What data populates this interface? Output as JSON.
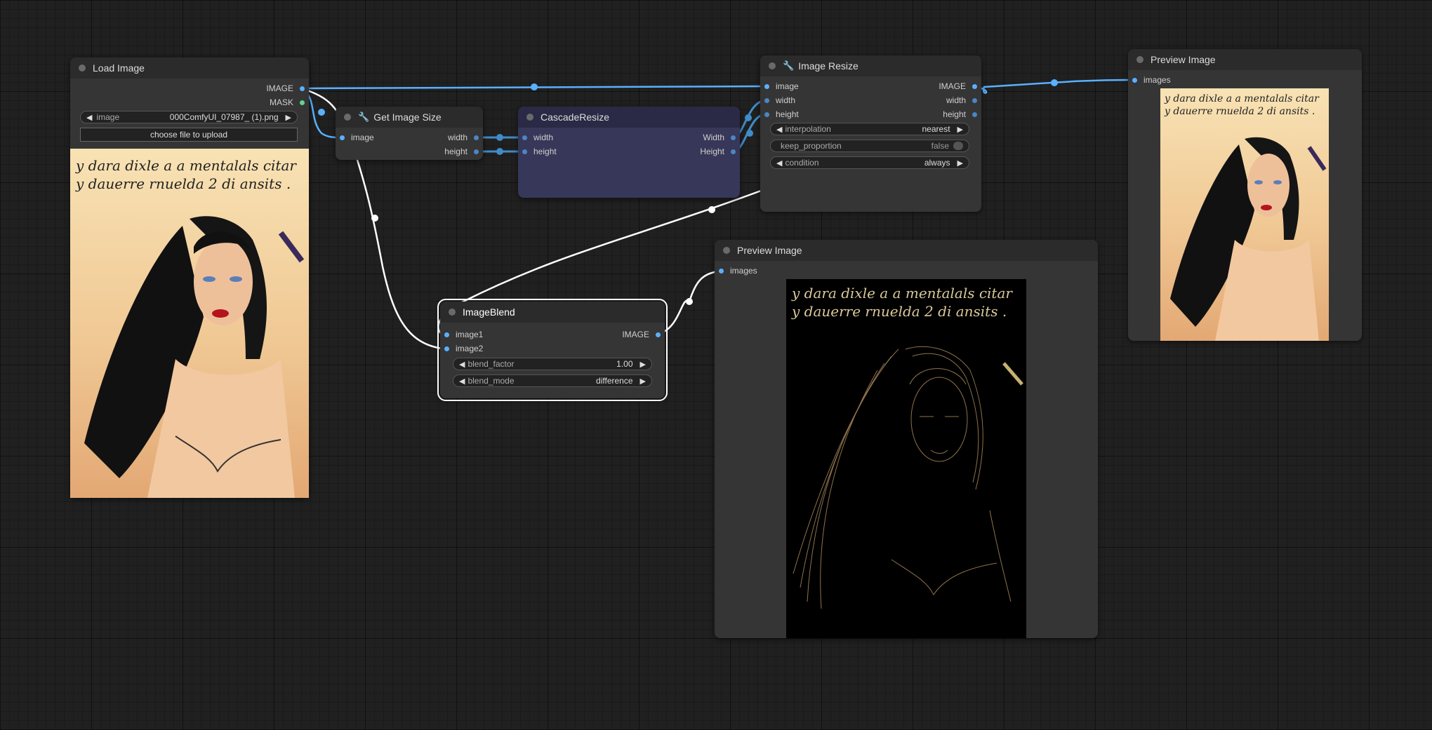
{
  "nodes": {
    "load_image": {
      "title": "Load Image",
      "outputs": [
        "IMAGE",
        "MASK"
      ],
      "widget_label": "image",
      "widget_value": "000ComfyUI_07987_ (1).png",
      "upload_label": "choose file to upload"
    },
    "get_image_size": {
      "title": "Get Image Size",
      "inputs": [
        "image"
      ],
      "outputs": [
        "width",
        "height"
      ]
    },
    "cascade_resize": {
      "title": "CascadeResize",
      "inputs": [
        "width",
        "height"
      ],
      "outputs": [
        "Width",
        "Height"
      ]
    },
    "image_resize": {
      "title": "Image Resize",
      "inputs": [
        "image",
        "width",
        "height"
      ],
      "outputs": [
        "IMAGE",
        "width",
        "height"
      ],
      "widgets": [
        {
          "label": "interpolation",
          "value": "nearest"
        },
        {
          "label": "keep_proportion",
          "value": "false"
        },
        {
          "label": "condition",
          "value": "always"
        }
      ]
    },
    "preview_top": {
      "title": "Preview Image",
      "inputs": [
        "images"
      ]
    },
    "preview_bottom": {
      "title": "Preview Image",
      "inputs": [
        "images"
      ]
    },
    "image_blend": {
      "title": "ImageBlend",
      "inputs": [
        "image1",
        "image2"
      ],
      "outputs": [
        "IMAGE"
      ],
      "widgets": [
        {
          "label": "blend_factor",
          "value": "1.00"
        },
        {
          "label": "blend_mode",
          "value": "difference"
        }
      ]
    }
  },
  "image_caption": [
    "y dara dixle a a mentalals citar",
    "y dauerre rnuelda 2 di ansits ."
  ],
  "colors": {
    "image_wire": "#5ab0ff",
    "selected_wire": "#ffffff",
    "int_wire": "#3f8cc8",
    "canvas": "#202020",
    "node": "#353535",
    "cascade_node": "#373759"
  }
}
